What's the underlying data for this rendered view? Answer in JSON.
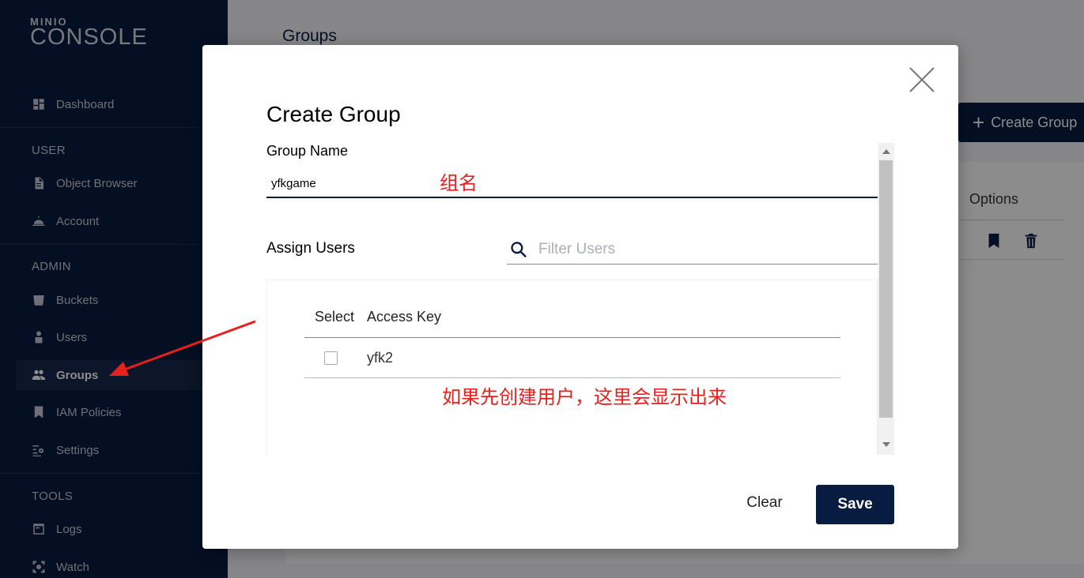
{
  "app": {
    "logo_top": "MINIO",
    "logo_bottom": "CONSOLE"
  },
  "sidebar": {
    "dashboard": "Dashboard",
    "section_user": "USER",
    "object_browser": "Object Browser",
    "account": "Account",
    "section_admin": "ADMIN",
    "buckets": "Buckets",
    "users": "Users",
    "groups": "Groups",
    "iam_policies": "IAM Policies",
    "settings": "Settings",
    "section_tools": "TOOLS",
    "logs": "Logs",
    "watch": "Watch"
  },
  "background": {
    "page_title": "Groups",
    "create_group_label": "Create Group",
    "options_header": "Options"
  },
  "modal": {
    "title": "Create Group",
    "group_name_label": "Group Name",
    "group_name_value": "yfkgame",
    "assign_users_label": "Assign Users",
    "filter_placeholder": "Filter Users",
    "columns": {
      "select": "Select",
      "access_key": "Access Key"
    },
    "rows": [
      {
        "access_key": "yfk2"
      }
    ],
    "clear_label": "Clear",
    "save_label": "Save"
  },
  "annotations": {
    "group_name_note": "组名",
    "users_note": "如果先创建用户，这里会显示出来",
    "color": "#e8201c"
  },
  "colors": {
    "sidebar_bg": "#081c42",
    "primary": "#081c42"
  }
}
